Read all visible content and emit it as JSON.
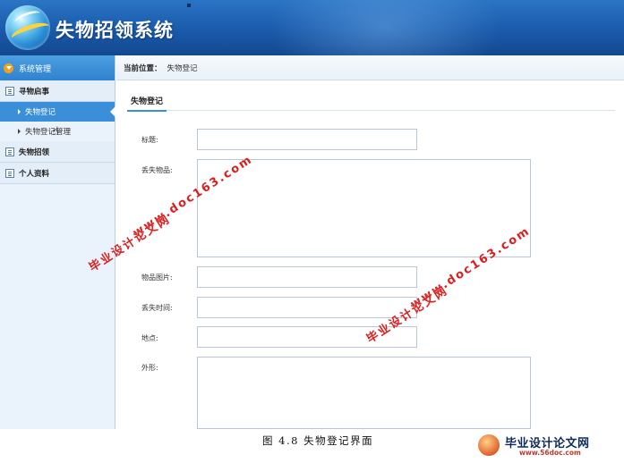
{
  "app": {
    "title": "失物招领系统"
  },
  "sidebar": {
    "header": "系统管理",
    "groups": [
      {
        "label": "寻物启事",
        "items": [
          {
            "label": "失物登记",
            "active": true
          },
          {
            "label": "失物登记管理",
            "active": false
          }
        ]
      },
      {
        "label": "失物招领",
        "items": []
      },
      {
        "label": "个人资料",
        "items": []
      }
    ]
  },
  "breadcrumb": {
    "label": "当前位置：",
    "value": "失物登记"
  },
  "tab": {
    "label": "失物登记"
  },
  "form": {
    "title_label": "标题:",
    "item_label": "丢失物品:",
    "image_label": "物品图片:",
    "time_label": "丢失时间:",
    "place_label": "地点:",
    "shape_label": "外形:"
  },
  "caption": "图 4.8  失物登记界面",
  "watermark": {
    "site_cn": "毕业设计论文网",
    "site_url": "www.doc163.com"
  },
  "badge": {
    "name": "毕业设计论文网",
    "url": "www.56doc.com"
  },
  "colors": {
    "header": "#1a5aab",
    "accent": "#3b8fd8",
    "watermark": "#d82020"
  }
}
